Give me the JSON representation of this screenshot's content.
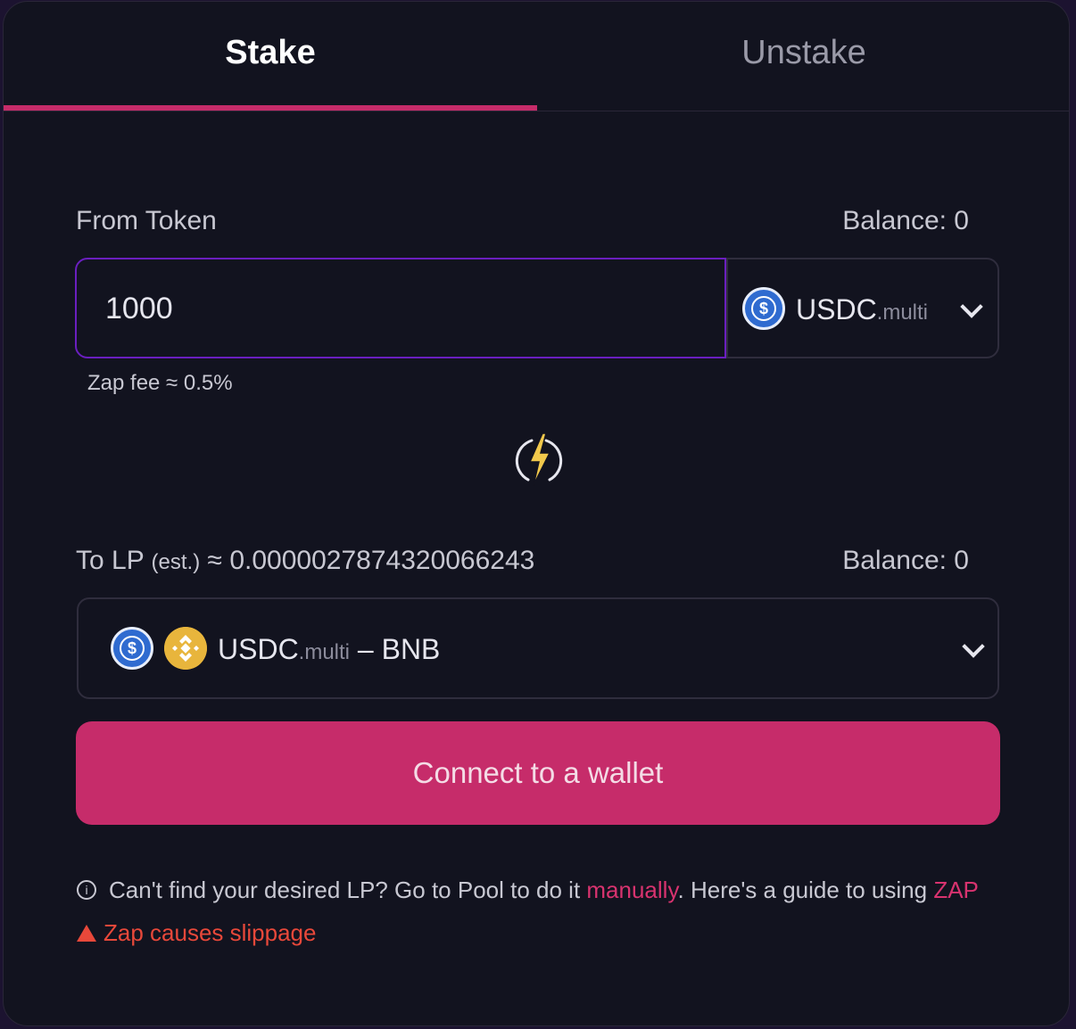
{
  "tabs": {
    "stake": "Stake",
    "unstake": "Unstake",
    "active": "stake"
  },
  "from": {
    "label": "From Token",
    "balance": "Balance: 0",
    "amount": "1000",
    "token": {
      "symbol": "USDC",
      "suffix": ".multi",
      "icon": "usdc-coin-icon"
    },
    "zap_fee": "Zap fee ≈ 0.5%"
  },
  "to": {
    "label": "To LP",
    "est": "(est.)",
    "estimate": "≈ 0.0000027874320066243",
    "balance": "Balance: 0",
    "lp": {
      "token_a": "USDC",
      "suffix": ".multi",
      "separator": "–",
      "token_b": "BNB"
    }
  },
  "connect_button": "Connect to a wallet",
  "info": {
    "text_before": "Can't find your desired LP? Go to Pool to do it ",
    "link1": "manually",
    "text_middle": ". Here's a guide to using ",
    "link2": "ZAP"
  },
  "warning": "Zap causes slippage",
  "colors": {
    "accent": "#c62c6a",
    "focus_border": "#6a1fbf",
    "warning": "#e8483a",
    "zap_bolt": "#f2c94c"
  }
}
